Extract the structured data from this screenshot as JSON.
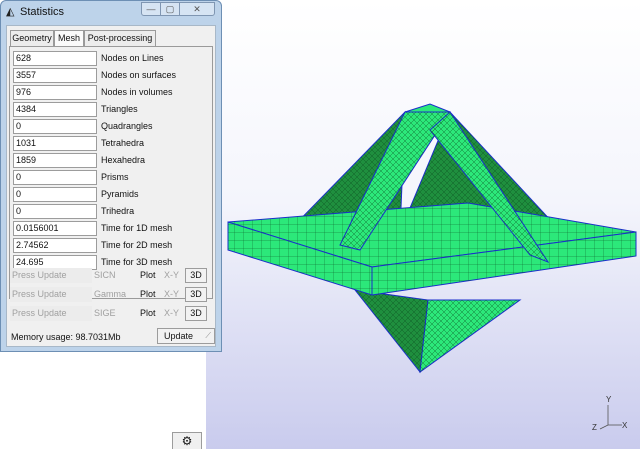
{
  "window": {
    "title": "Statistics",
    "title_icon": "gmsh-icon",
    "minimize_symbol": "—",
    "maximize_symbol": "▢",
    "close_symbol": "✕"
  },
  "tabs": [
    {
      "label": "Geometry"
    },
    {
      "label": "Mesh"
    },
    {
      "label": "Post-processing"
    }
  ],
  "stats": [
    {
      "value": "628",
      "label": "Nodes on Lines"
    },
    {
      "value": "3557",
      "label": "Nodes on surfaces"
    },
    {
      "value": "976",
      "label": "Nodes in volumes"
    },
    {
      "value": "4384",
      "label": "Triangles"
    },
    {
      "value": "0",
      "label": "Quadrangles"
    },
    {
      "value": "1031",
      "label": "Tetrahedra"
    },
    {
      "value": "1859",
      "label": "Hexahedra"
    },
    {
      "value": "0",
      "label": "Prisms"
    },
    {
      "value": "0",
      "label": "Pyramids"
    },
    {
      "value": "0",
      "label": "Trihedra"
    },
    {
      "value": "0.0156001",
      "label": "Time for 1D mesh"
    },
    {
      "value": "2.74562",
      "label": "Time for 2D mesh"
    },
    {
      "value": "24.695",
      "label": "Time for 3D mesh"
    }
  ],
  "quality": [
    {
      "placeholder": "Press Update",
      "name": "SICN",
      "plot": "Plot",
      "xy": "X-Y",
      "threed": "3D"
    },
    {
      "placeholder": "Press Update",
      "name": "Gamma",
      "plot": "Plot",
      "xy": "X-Y",
      "threed": "3D"
    },
    {
      "placeholder": "Press Update",
      "name": "SIGE",
      "plot": "Plot",
      "xy": "X-Y",
      "threed": "3D"
    }
  ],
  "memory_text": "Memory usage: 98.7031Mb",
  "update_label": "Update",
  "gear_symbol": "⚙",
  "axes": {
    "x": "X",
    "y": "Y",
    "z": "Z"
  },
  "colors": {
    "mesh_fill": "#2ce87a",
    "mesh_dark": "#1f8f3e",
    "mesh_edge": "#1a2ecc"
  }
}
